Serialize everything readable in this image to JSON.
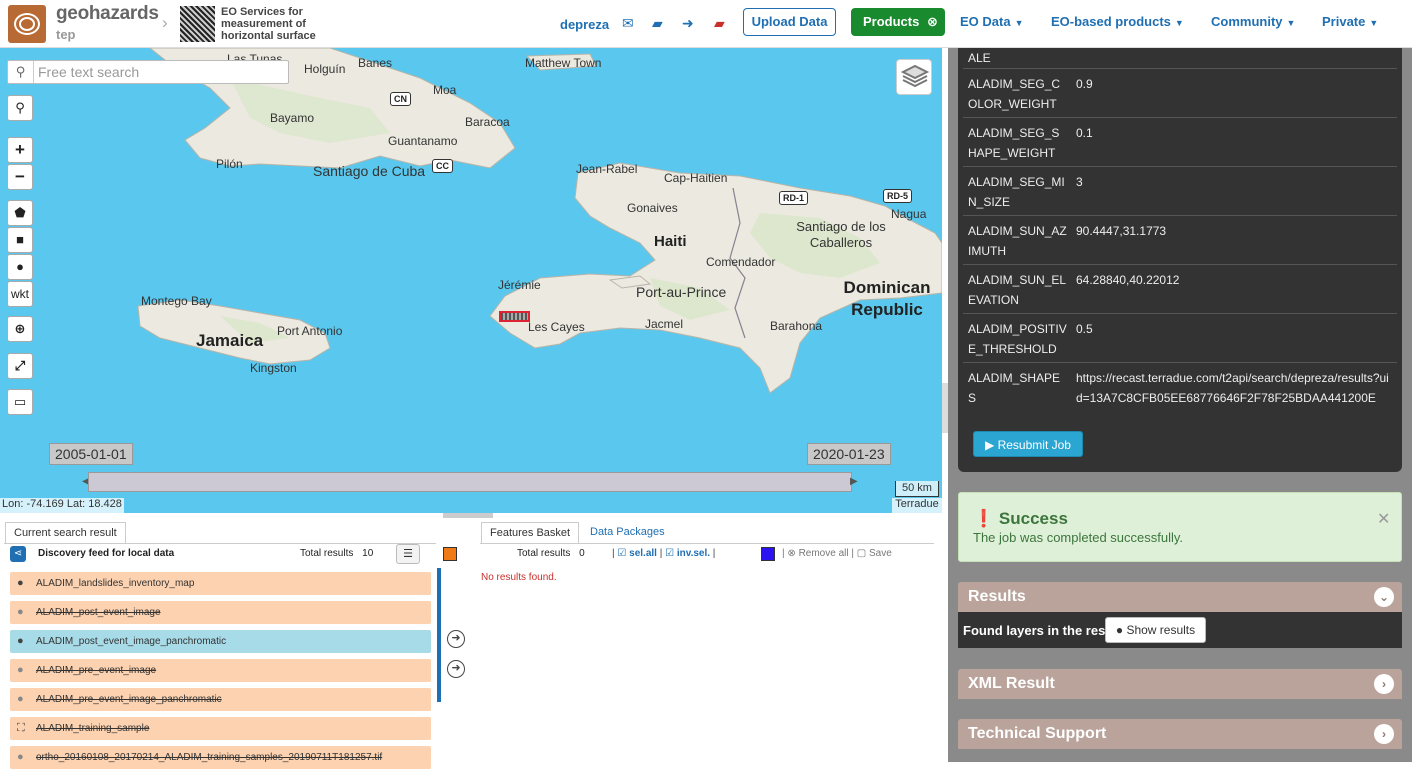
{
  "header": {
    "logo_title": "geohazards",
    "logo_sub": "tep",
    "crumb_text": "EO Services for measurement of horizontal surface",
    "user": "depreza",
    "upload_label": "Upload Data",
    "products_label": "Products",
    "menus": [
      "EO Data",
      "EO-based products",
      "Community",
      "Private"
    ]
  },
  "map": {
    "search_placeholder": "Free text search",
    "wkt_label": "wkt",
    "date_start": "2005-01-01",
    "date_end": "2020-01-23",
    "scale_label": "50 km",
    "attribution": "Terradue",
    "coords": "Lon: -74.169 Lat: 18.428",
    "labels": {
      "holguin": "Holguín",
      "banes": "Banes",
      "moa": "Moa",
      "bayamo": "Bayamo",
      "baracoa": "Baracoa",
      "guantanamo": "Guantanamo",
      "pilon": "Pilón",
      "santiago_cuba": "Santiago de Cuba",
      "matthew_town": "Matthew Town",
      "jean_rabel": "Jean-Rabel",
      "cap_haitien": "Cap-Haitien",
      "gonaives": "Gonaives",
      "haiti": "Haiti",
      "santiago_caballeros": "Santiago de los Caballeros",
      "nagua": "Nagua",
      "comendador": "Comendador",
      "jeremie": "Jérémie",
      "port_au_prince": "Port-au-Prince",
      "dominican": "Dominican Republic",
      "les_cayes": "Les Cayes",
      "jacmel": "Jacmel",
      "barahona": "Barahona",
      "montego_bay": "Montego Bay",
      "port_antonio": "Port Antonio",
      "jamaica": "Jamaica",
      "kingston": "Kingston",
      "las_tunas": "Las Tunas"
    },
    "shields": [
      "CN",
      "CC",
      "RD-1",
      "RD-5"
    ]
  },
  "search_result": {
    "tab_label": "Current search result",
    "feed_title": "Discovery feed for local data",
    "total_label": "Total results",
    "total_value": "10",
    "rows": [
      {
        "label": "ALADIM_landslides_inventory_map"
      },
      {
        "label": "ALADIM_post_event_image"
      },
      {
        "label": "ALADIM_post_event_image_panchromatic"
      },
      {
        "label": "ALADIM_pre_event_image"
      },
      {
        "label": "ALADIM_pre_event_image_panchromatic"
      },
      {
        "label": "ALADIM_training_sample"
      },
      {
        "label": "ortho_20160108_20170214_ALADIM_training_samples_20190711T181257.tif"
      }
    ]
  },
  "basket": {
    "tab_label": "Features Basket",
    "tab2_label": "Data Packages",
    "total_label": "Total results",
    "total_value": "0",
    "sel_all": "sel.all",
    "inv_sel": "inv.sel.",
    "remove_all": "Remove all",
    "save": "Save",
    "no_results": "No results found."
  },
  "job": {
    "params": [
      {
        "key": "ALE",
        "value": ""
      },
      {
        "key": "ALADIM_SEG_COLOR_WEIGHT",
        "value": "0.9"
      },
      {
        "key": "ALADIM_SEG_SHAPE_WEIGHT",
        "value": "0.1"
      },
      {
        "key": "ALADIM_SEG_MIN_SIZE",
        "value": "3"
      },
      {
        "key": "ALADIM_SUN_AZIMUTH",
        "value": "90.4447,31.1773"
      },
      {
        "key": "ALADIM_SUN_ELEVATION",
        "value": "64.28840,40.22012"
      },
      {
        "key": "ALADIM_POSITIVE_THRESHOLD",
        "value": "0.5"
      },
      {
        "key": "ALADIM_SHAPES",
        "value": "https://recast.terradue.com/t2api/search/depreza/results?uid=13A7C8CFB05EE68776646F2F78F25BDAA441200E"
      }
    ],
    "resubmit_label": "Resubmit Job",
    "success_title": "Success",
    "success_message": "The job was completed successfully.",
    "sections": {
      "results": "Results",
      "found_layers": "Found layers in the result.",
      "show_results": "Show results",
      "xml": "XML Result",
      "support": "Technical Support"
    }
  },
  "colors": {
    "accent": "#1f6fb2",
    "products_green": "#1a8a2e",
    "sea": "#5ac8ee",
    "land": "#eceae0",
    "result_orange": "#fcd2b0",
    "result_blue": "#a8dbe8",
    "success_bg": "#dff0d8",
    "section_bg": "#b9a39b"
  }
}
